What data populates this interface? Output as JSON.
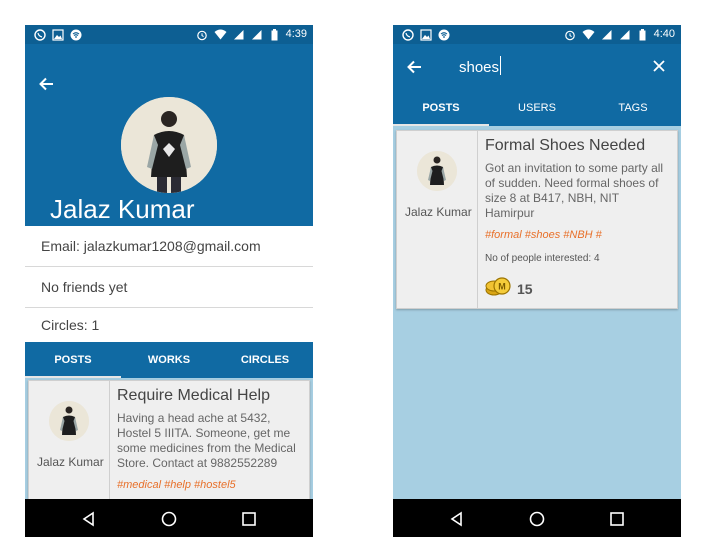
{
  "left": {
    "status": {
      "time": "4:39"
    },
    "profile": {
      "name": "Jalaz Kumar",
      "email": "Email: jalazkumar1208@gmail.com",
      "friends": "No friends yet",
      "circles": "Circles: 1"
    },
    "tabs": [
      "POSTS",
      "WORKS",
      "CIRCLES"
    ],
    "active_tab": "POSTS",
    "post": {
      "author": "Jalaz Kumar",
      "title": "Require Medical Help",
      "description": "Having a head ache at 5432, Hostel 5 IIITA. Someone, get me some medicines from the Medical Store. Contact at 9882552289",
      "tags": "#medical #help #hostel5"
    }
  },
  "right": {
    "status": {
      "time": "4:40"
    },
    "search": {
      "query": "shoes"
    },
    "tabs": [
      "POSTS",
      "USERS",
      "TAGS"
    ],
    "active_tab": "POSTS",
    "post": {
      "author": "Jalaz Kumar",
      "title": "Formal Shoes Needed",
      "description": "Got an invitation to some party all of sudden. Need formal shoes of size 8 at B417, NBH, NIT Hamirpur",
      "tags": "#formal #shoes #NBH #",
      "interested": "No of people interested: 4",
      "coins": "15"
    }
  },
  "icons": {
    "status_left": [
      "whatsapp-icon",
      "image-icon",
      "hotspot-icon"
    ],
    "status_right": [
      "alarm-icon",
      "wifi-icon",
      "signal-icon",
      "battery-icon"
    ],
    "nav": [
      "back-triangle-icon",
      "home-circle-icon",
      "recents-square-icon"
    ]
  },
  "colors": {
    "primary": "#106aa3",
    "status_bar": "#0d5f93",
    "tag_orange": "#e8702a",
    "results_bg": "#a7cfe2"
  }
}
